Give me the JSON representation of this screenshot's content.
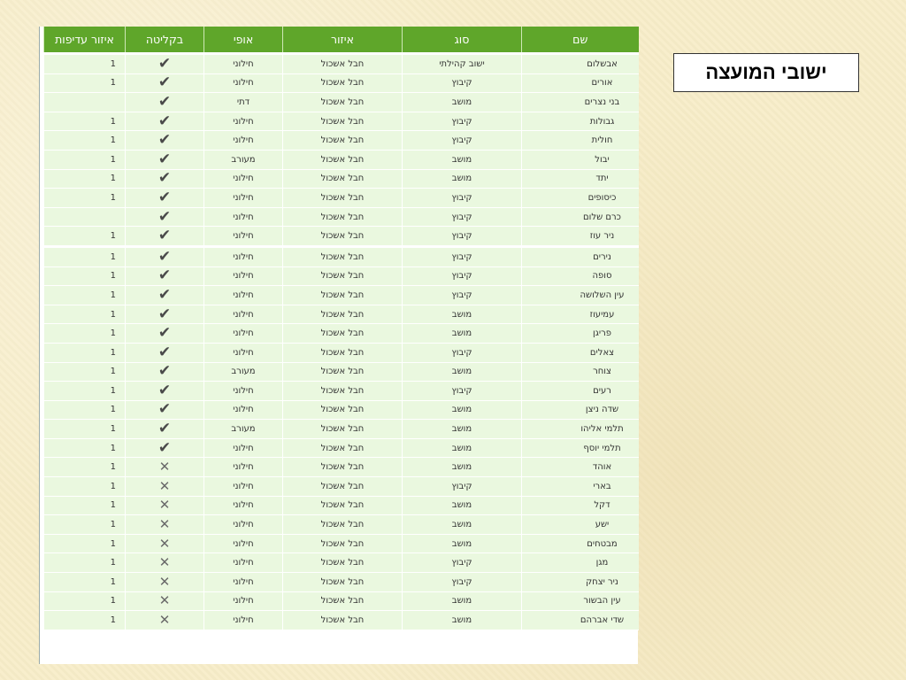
{
  "title": "ישובי המועצה",
  "headers": {
    "name": "שם",
    "type": "סוג",
    "region": "איזור",
    "character": "אופי",
    "absorption": "בקליטה",
    "priority": "איזור עדיפות"
  },
  "icons": {
    "yes": "check-icon",
    "no": "x-icon"
  },
  "colors": {
    "header": "#5fa62a",
    "row": "#eaf8df"
  },
  "rows": [
    {
      "name": "אבשלום",
      "type": "ישוב קהילתי",
      "region": "חבל אשכול",
      "character": "חילוני",
      "absorption": "✔",
      "priority": "1"
    },
    {
      "name": "אורים",
      "type": "קיבוץ",
      "region": "חבל אשכול",
      "character": "חילוני",
      "absorption": "✔",
      "priority": "1"
    },
    {
      "name": "בני נצרים",
      "type": "מושב",
      "region": "חבל אשכול",
      "character": "דתי",
      "absorption": "✔",
      "priority": ""
    },
    {
      "name": "גבולות",
      "type": "קיבוץ",
      "region": "חבל אשכול",
      "character": "חילוני",
      "absorption": "✔",
      "priority": "1"
    },
    {
      "name": "חולית",
      "type": "קיבוץ",
      "region": "חבל אשכול",
      "character": "חילוני",
      "absorption": "✔",
      "priority": "1"
    },
    {
      "name": "יבול",
      "type": "מושב",
      "region": "חבל אשכול",
      "character": "מעורב",
      "absorption": "✔",
      "priority": "1"
    },
    {
      "name": "יתד",
      "type": "מושב",
      "region": "חבל אשכול",
      "character": "חילוני",
      "absorption": "✔",
      "priority": "1"
    },
    {
      "name": "כיסופים",
      "type": "קיבוץ",
      "region": "חבל אשכול",
      "character": "חילוני",
      "absorption": "✔",
      "priority": "1"
    },
    {
      "name": "כרם שלום",
      "type": "קיבוץ",
      "region": "חבל אשכול",
      "character": "חילוני",
      "absorption": "✔",
      "priority": ""
    },
    {
      "name": "ניר עוז",
      "type": "קיבוץ",
      "region": "חבל אשכול",
      "character": "חילוני",
      "absorption": "✔",
      "priority": "1"
    },
    {
      "name": "נירים",
      "type": "קיבוץ",
      "region": "חבל אשכול",
      "character": "חילוני",
      "absorption": "✔",
      "priority": "1"
    },
    {
      "name": "סופה",
      "type": "קיבוץ",
      "region": "חבל אשכול",
      "character": "חילוני",
      "absorption": "✔",
      "priority": "1"
    },
    {
      "name": "עין השלושה",
      "type": "קיבוץ",
      "region": "חבל אשכול",
      "character": "חילוני",
      "absorption": "✔",
      "priority": "1"
    },
    {
      "name": "עמיעוז",
      "type": "מושב",
      "region": "חבל אשכול",
      "character": "חילוני",
      "absorption": "✔",
      "priority": "1"
    },
    {
      "name": "פריגן",
      "type": "מושב",
      "region": "חבל אשכול",
      "character": "חילוני",
      "absorption": "✔",
      "priority": "1"
    },
    {
      "name": "צאלים",
      "type": "קיבוץ",
      "region": "חבל אשכול",
      "character": "חילוני",
      "absorption": "✔",
      "priority": "1"
    },
    {
      "name": "צוחר",
      "type": "מושב",
      "region": "חבל אשכול",
      "character": "מעורב",
      "absorption": "✔",
      "priority": "1"
    },
    {
      "name": "רעים",
      "type": "קיבוץ",
      "region": "חבל אשכול",
      "character": "חילוני",
      "absorption": "✔",
      "priority": "1"
    },
    {
      "name": "שדה ניצן",
      "type": "מושב",
      "region": "חבל אשכול",
      "character": "חילוני",
      "absorption": "✔",
      "priority": "1"
    },
    {
      "name": "תלמי אליהו",
      "type": "מושב",
      "region": "חבל אשכול",
      "character": "מעורב",
      "absorption": "✔",
      "priority": "1"
    },
    {
      "name": "תלמי יוסף",
      "type": "מושב",
      "region": "חבל אשכול",
      "character": "חילוני",
      "absorption": "✔",
      "priority": "1"
    },
    {
      "name": "אוהד",
      "type": "מושב",
      "region": "חבל אשכול",
      "character": "חילוני",
      "absorption": "✕",
      "priority": "1"
    },
    {
      "name": "בארי",
      "type": "קיבוץ",
      "region": "חבל אשכול",
      "character": "חילוני",
      "absorption": "✕",
      "priority": "1"
    },
    {
      "name": "דקל",
      "type": "מושב",
      "region": "חבל אשכול",
      "character": "חילוני",
      "absorption": "✕",
      "priority": "1"
    },
    {
      "name": "ישע",
      "type": "מושב",
      "region": "חבל אשכול",
      "character": "חילוני",
      "absorption": "✕",
      "priority": "1"
    },
    {
      "name": "מבטחים",
      "type": "מושב",
      "region": "חבל אשכול",
      "character": "חילוני",
      "absorption": "✕",
      "priority": "1"
    },
    {
      "name": "מגן",
      "type": "קיבוץ",
      "region": "חבל אשכול",
      "character": "חילוני",
      "absorption": "✕",
      "priority": "1"
    },
    {
      "name": "ניר יצחק",
      "type": "קיבוץ",
      "region": "חבל אשכול",
      "character": "חילוני",
      "absorption": "✕",
      "priority": "1"
    },
    {
      "name": "עין הבשור",
      "type": "מושב",
      "region": "חבל אשכול",
      "character": "חילוני",
      "absorption": "✕",
      "priority": "1"
    },
    {
      "name": "שדי אברהם",
      "type": "מושב",
      "region": "חבל אשכול",
      "character": "חילוני",
      "absorption": "✕",
      "priority": "1"
    }
  ]
}
